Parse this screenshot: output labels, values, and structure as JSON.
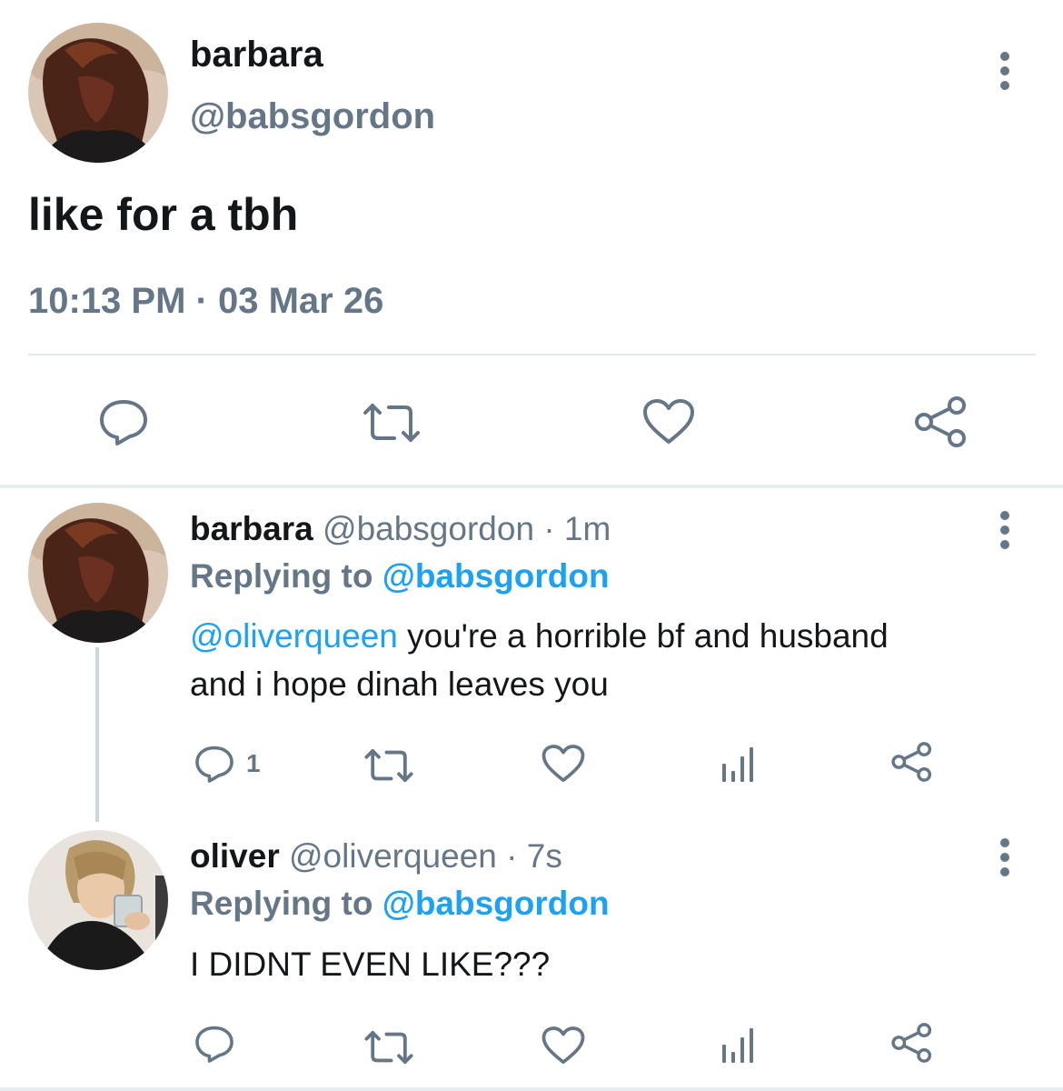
{
  "main_tweet": {
    "display_name": "barbara",
    "handle": "@babsgordon",
    "text": "like for a tbh",
    "timestamp": "10:13 PM · 03 Mar 26",
    "actions": [
      "reply-icon",
      "retweet-icon",
      "like-icon",
      "share-icon"
    ]
  },
  "replies": [
    {
      "display_name": "barbara",
      "handle": "@babsgordon",
      "separator": "·",
      "time": "1m",
      "replying_prefix": "Replying to",
      "replying_handle": "@babsgordon",
      "mention": "@oliverqueen",
      "text_after_mention": "you're a horrible bf and husband and i hope dinah leaves you",
      "reply_count": "1",
      "actions": [
        "reply-icon",
        "retweet-icon",
        "like-icon",
        "analytics-icon",
        "share-icon"
      ]
    },
    {
      "display_name": "oliver",
      "handle": "@oliverqueen",
      "separator": "·",
      "time": "7s",
      "replying_prefix": "Replying to",
      "replying_handle": "@babsgordon",
      "text": "I DIDNT EVEN LIKE???",
      "actions": [
        "reply-icon",
        "retweet-icon",
        "like-icon",
        "analytics-icon",
        "share-icon"
      ]
    }
  ],
  "colors": {
    "accent": "#1da1f2",
    "secondary_text": "#657786",
    "primary_text": "#14171a",
    "divider": "#e1e8ed"
  }
}
